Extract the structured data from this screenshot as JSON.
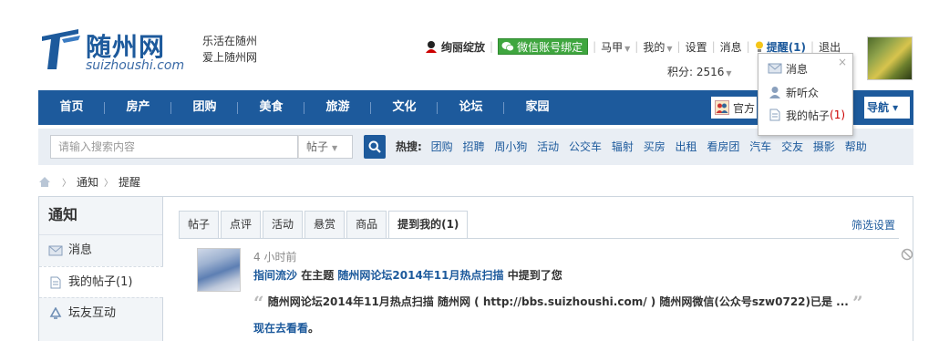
{
  "logo": {
    "cn": "随州网",
    "en": "suizhoushi.com"
  },
  "slogan": {
    "line1": "乐活在随州",
    "line2": "爱上随州网"
  },
  "topbar": {
    "username": "绚丽绽放",
    "wechat_bind": "微信账号绑定",
    "marker": "马甲",
    "mine": "我的",
    "settings": "设置",
    "messages": "消息",
    "remind": "提醒(1)",
    "logout": "退出",
    "points": "积分: 2516"
  },
  "dropdown": {
    "close": "×",
    "items": [
      {
        "label": "消息"
      },
      {
        "label": "新听众"
      },
      {
        "label": "我的帖子",
        "count": "(1)"
      }
    ]
  },
  "nav": {
    "items": [
      "首页",
      "房产",
      "团购",
      "美食",
      "旅游",
      "文化",
      "论坛",
      "家园"
    ],
    "official": "官方",
    "guide": "导航 ▾"
  },
  "search": {
    "placeholder": "请输入搜索内容",
    "type": "帖子",
    "hot_label": "热搜:",
    "hot": [
      "团购",
      "招聘",
      "周小狗",
      "活动",
      "公交车",
      "辐射",
      "买房",
      "出租",
      "看房团",
      "汽车",
      "交友",
      "摄影",
      "帮助"
    ]
  },
  "breadcrumb": {
    "items": [
      "通知",
      "提醒"
    ]
  },
  "sidebar": {
    "title": "通知",
    "items": [
      {
        "label": "消息"
      },
      {
        "label": "我的帖子(1)"
      },
      {
        "label": "坛友互动"
      }
    ]
  },
  "tabs": [
    "帖子",
    "点评",
    "活动",
    "悬赏",
    "商品",
    "提到我的(1)"
  ],
  "filter": "筛选设置",
  "notice": {
    "time": "4 小时前",
    "user": "指间流沙",
    "in_topic": "在主题",
    "topic": "随州网论坛2014年11月热点扫描",
    "mentioned": "中提到了您",
    "quote": "随州网论坛2014年11月热点扫描 随州网 ( http://bbs.suizhoushi.com/ ) 随州网微信(公众号szw0722)已是 ...",
    "go": "现在去看看",
    "go_dot": "。"
  },
  "colors": {
    "brand": "#1d5a9c",
    "wechat": "#3fa63f",
    "alert": "#cc0000"
  }
}
